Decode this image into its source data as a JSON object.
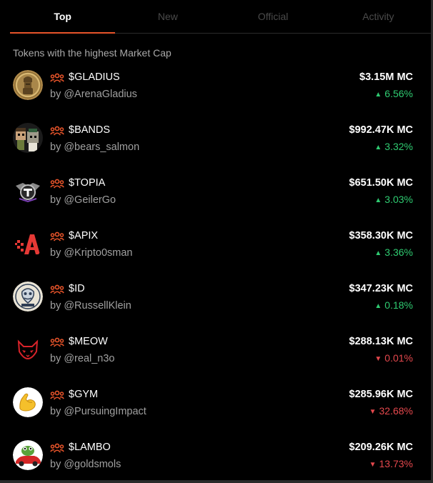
{
  "tabs": [
    {
      "label": "Top",
      "active": true
    },
    {
      "label": "New",
      "active": false
    },
    {
      "label": "Official",
      "active": false
    },
    {
      "label": "Activity",
      "active": false
    }
  ],
  "subtitle": "Tokens with the highest Market Cap",
  "colors": {
    "accent": "#e8542a",
    "up": "#2fcb71",
    "down": "#e5484d"
  },
  "tokens": [
    {
      "ticker": "$GLADIUS",
      "creator": "by @ArenaGladius",
      "market_cap": "$3.15M MC",
      "change": "6.56%",
      "direction": "up",
      "icon": "gladiator-coin-avatar"
    },
    {
      "ticker": "$BANDS",
      "creator": "by @bears_salmon",
      "market_cap": "$992.47K MC",
      "change": "3.32%",
      "direction": "up",
      "icon": "pixel-characters-avatar"
    },
    {
      "ticker": "$TOPIA",
      "creator": "by @GeilerGo",
      "market_cap": "$651.50K MC",
      "change": "3.03%",
      "direction": "up",
      "icon": "topia-logo-avatar"
    },
    {
      "ticker": "$APIX",
      "creator": "by @Kripto0sman",
      "market_cap": "$358.30K MC",
      "change": "3.36%",
      "direction": "up",
      "icon": "apix-logo-avatar"
    },
    {
      "ticker": "$ID",
      "creator": "by @RussellKlein",
      "market_cap": "$347.23K MC",
      "change": "0.18%",
      "direction": "up",
      "icon": "id-emblem-avatar"
    },
    {
      "ticker": "$MEOW",
      "creator": "by @real_n3o",
      "market_cap": "$288.13K MC",
      "change": "0.01%",
      "direction": "down",
      "icon": "cat-mask-avatar"
    },
    {
      "ticker": "$GYM",
      "creator": "by @PursuingImpact",
      "market_cap": "$285.96K MC",
      "change": "32.68%",
      "direction": "down",
      "icon": "flexed-biceps-avatar"
    },
    {
      "ticker": "$LAMBO",
      "creator": "by @goldsmols",
      "market_cap": "$209.26K MC",
      "change": "13.73%",
      "direction": "down",
      "icon": "frog-car-avatar"
    }
  ]
}
